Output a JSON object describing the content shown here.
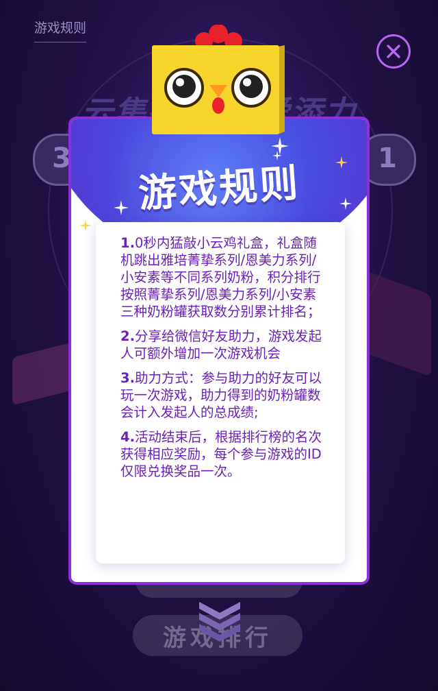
{
  "background": {
    "rules_link": "游戏规则",
    "headline": "云集各方 为爱添力",
    "left_pill": "3",
    "right_pill": "1",
    "rank_button": "游戏排行"
  },
  "modal": {
    "title": "游戏规则",
    "rules": [
      {
        "num": "1.",
        "text": "0秒内猛敲小云鸡礼盒，礼盒随机跳出雅培菁挚系列/恩美力系列/小安素等不同系列奶粉，积分排行按照菁挚系列/恩美力系列/小安素三种奶粉罐获取数分别累计排名；"
      },
      {
        "num": "2.",
        "text": "分享给微信好友助力，游戏发起人可额外增加一次游戏机会"
      },
      {
        "num": "3.",
        "text": "助力方式：参与助力的好友可以玩一次游戏，助力得到的奶粉罐数会计入发起人的总成绩;"
      },
      {
        "num": "4.",
        "text": "活动结束后，根据排行榜的名次获得相应奖励，每个参与游戏的ID仅限兑换奖品一次。"
      }
    ]
  },
  "colors": {
    "modal_border": "#8e2fdc",
    "rule_text": "#6a21b8",
    "close_ring": "#b665f5",
    "mascot_body": "#f7d52c",
    "mascot_comb": "#e8212b"
  },
  "icons": [
    "close-icon",
    "sparkle-icon",
    "chick-mascot",
    "chevron-down-icon"
  ]
}
